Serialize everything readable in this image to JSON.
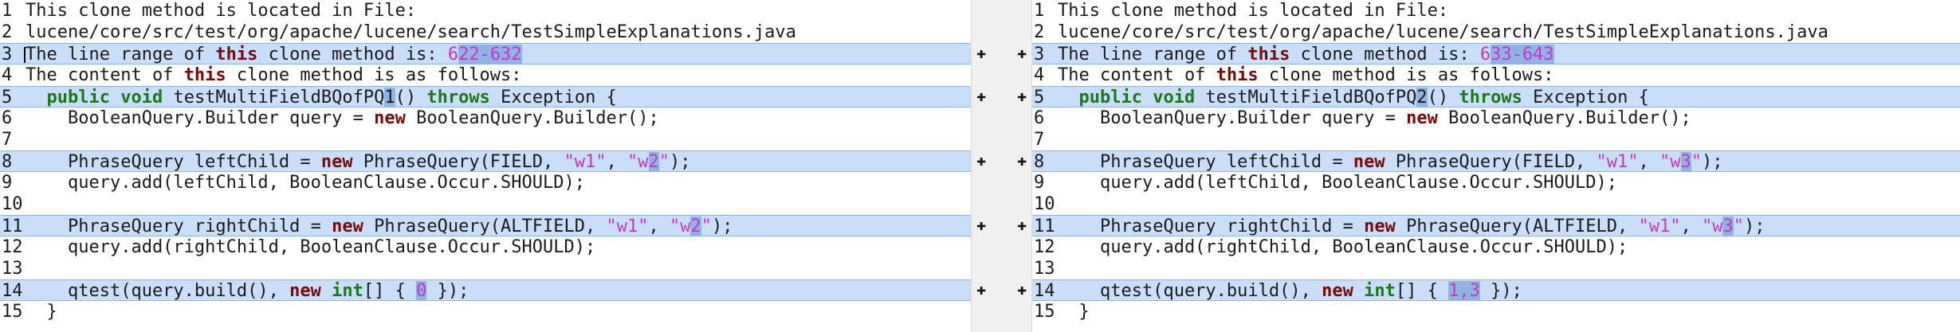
{
  "left": {
    "lines": [
      {
        "n": "1",
        "parts": [
          {
            "t": "This clone method is located in File:"
          }
        ]
      },
      {
        "n": "2",
        "parts": [
          {
            "t": "lucene/core/src/test/org/apache/lucene/search/TestSimpleExplanations.java"
          }
        ]
      },
      {
        "n": "3",
        "parts": [
          {
            "t": "The line range of "
          },
          {
            "t": "this",
            "c": "kw"
          },
          {
            "t": " clone method is: "
          },
          {
            "t": "6",
            "c": "num"
          },
          {
            "t": "22-632",
            "c": "num hl"
          }
        ]
      },
      {
        "n": "4",
        "parts": [
          {
            "t": "The content of "
          },
          {
            "t": "this",
            "c": "kw"
          },
          {
            "t": " clone method is as follows:"
          }
        ]
      },
      {
        "n": "5",
        "parts": [
          {
            "t": "  "
          },
          {
            "t": "public",
            "c": "kw2"
          },
          {
            "t": " "
          },
          {
            "t": "void",
            "c": "kw2"
          },
          {
            "t": " testMultiFieldBQofPQ"
          },
          {
            "t": "1",
            "c": "hl"
          },
          {
            "t": "() "
          },
          {
            "t": "throws",
            "c": "kw2"
          },
          {
            "t": " Exception {"
          }
        ]
      },
      {
        "n": "6",
        "parts": [
          {
            "t": "    BooleanQuery.Builder query = "
          },
          {
            "t": "new",
            "c": "kw"
          },
          {
            "t": " BooleanQuery.Builder();"
          }
        ]
      },
      {
        "n": "7",
        "parts": [
          {
            "t": ""
          }
        ]
      },
      {
        "n": "8",
        "parts": [
          {
            "t": "    PhraseQuery leftChild = "
          },
          {
            "t": "new",
            "c": "kw"
          },
          {
            "t": " PhraseQuery(FIELD, "
          },
          {
            "t": "\"w1\"",
            "c": "str"
          },
          {
            "t": ", "
          },
          {
            "t": "\"w",
            "c": "str"
          },
          {
            "t": "2",
            "c": "str hl"
          },
          {
            "t": "\"",
            "c": "str"
          },
          {
            "t": ");"
          }
        ]
      },
      {
        "n": "9",
        "parts": [
          {
            "t": "    query.add(leftChild, BooleanClause.Occur.SHOULD);"
          }
        ]
      },
      {
        "n": "10",
        "parts": [
          {
            "t": ""
          }
        ]
      },
      {
        "n": "11",
        "parts": [
          {
            "t": "    PhraseQuery rightChild = "
          },
          {
            "t": "new",
            "c": "kw"
          },
          {
            "t": " PhraseQuery(ALTFIELD, "
          },
          {
            "t": "\"w1\"",
            "c": "str"
          },
          {
            "t": ", "
          },
          {
            "t": "\"w",
            "c": "str"
          },
          {
            "t": "2",
            "c": "str hl"
          },
          {
            "t": "\"",
            "c": "str"
          },
          {
            "t": ");"
          }
        ]
      },
      {
        "n": "12",
        "parts": [
          {
            "t": "    query.add(rightChild, BooleanClause.Occur.SHOULD);"
          }
        ]
      },
      {
        "n": "13",
        "parts": [
          {
            "t": ""
          }
        ]
      },
      {
        "n": "14",
        "parts": [
          {
            "t": "    qtest(query.build(), "
          },
          {
            "t": "new",
            "c": "kw"
          },
          {
            "t": " "
          },
          {
            "t": "int",
            "c": "kw2"
          },
          {
            "t": "[] { "
          },
          {
            "t": "0",
            "c": "num hl"
          },
          {
            "t": " });"
          }
        ]
      },
      {
        "n": "15",
        "parts": [
          {
            "t": "  }"
          }
        ]
      }
    ]
  },
  "right": {
    "lines": [
      {
        "n": "1",
        "parts": [
          {
            "t": "This clone method is located in File:"
          }
        ]
      },
      {
        "n": "2",
        "parts": [
          {
            "t": "lucene/core/src/test/org/apache/lucene/search/TestSimpleExplanations.java"
          }
        ]
      },
      {
        "n": "3",
        "parts": [
          {
            "t": "The line range of "
          },
          {
            "t": "this",
            "c": "kw"
          },
          {
            "t": " clone method is: "
          },
          {
            "t": "6",
            "c": "num"
          },
          {
            "t": "33-643",
            "c": "num hl"
          }
        ]
      },
      {
        "n": "4",
        "parts": [
          {
            "t": "The content of "
          },
          {
            "t": "this",
            "c": "kw"
          },
          {
            "t": " clone method is as follows:"
          }
        ]
      },
      {
        "n": "5",
        "parts": [
          {
            "t": "  "
          },
          {
            "t": "public",
            "c": "kw2"
          },
          {
            "t": " "
          },
          {
            "t": "void",
            "c": "kw2"
          },
          {
            "t": " testMultiFieldBQofPQ"
          },
          {
            "t": "2",
            "c": "hl"
          },
          {
            "t": "() "
          },
          {
            "t": "throws",
            "c": "kw2"
          },
          {
            "t": " Exception {"
          }
        ]
      },
      {
        "n": "6",
        "parts": [
          {
            "t": "    BooleanQuery.Builder query = "
          },
          {
            "t": "new",
            "c": "kw"
          },
          {
            "t": " BooleanQuery.Builder();"
          }
        ]
      },
      {
        "n": "7",
        "parts": [
          {
            "t": ""
          }
        ]
      },
      {
        "n": "8",
        "parts": [
          {
            "t": "    PhraseQuery leftChild = "
          },
          {
            "t": "new",
            "c": "kw"
          },
          {
            "t": " PhraseQuery(FIELD, "
          },
          {
            "t": "\"w1\"",
            "c": "str"
          },
          {
            "t": ", "
          },
          {
            "t": "\"w",
            "c": "str"
          },
          {
            "t": "3",
            "c": "str hl"
          },
          {
            "t": "\"",
            "c": "str"
          },
          {
            "t": ");"
          }
        ]
      },
      {
        "n": "9",
        "parts": [
          {
            "t": "    query.add(leftChild, BooleanClause.Occur.SHOULD);"
          }
        ]
      },
      {
        "n": "10",
        "parts": [
          {
            "t": ""
          }
        ]
      },
      {
        "n": "11",
        "parts": [
          {
            "t": "    PhraseQuery rightChild = "
          },
          {
            "t": "new",
            "c": "kw"
          },
          {
            "t": " PhraseQuery(ALTFIELD, "
          },
          {
            "t": "\"w1\"",
            "c": "str"
          },
          {
            "t": ", "
          },
          {
            "t": "\"w",
            "c": "str"
          },
          {
            "t": "3",
            "c": "str hl"
          },
          {
            "t": "\"",
            "c": "str"
          },
          {
            "t": ");"
          }
        ]
      },
      {
        "n": "12",
        "parts": [
          {
            "t": "    query.add(rightChild, BooleanClause.Occur.SHOULD);"
          }
        ]
      },
      {
        "n": "13",
        "parts": [
          {
            "t": ""
          }
        ]
      },
      {
        "n": "14",
        "parts": [
          {
            "t": "    qtest(query.build(), "
          },
          {
            "t": "new",
            "c": "kw"
          },
          {
            "t": " "
          },
          {
            "t": "int",
            "c": "kw2"
          },
          {
            "t": "[] { "
          },
          {
            "t": "1,3",
            "c": "num hl"
          },
          {
            "t": " });"
          }
        ]
      },
      {
        "n": "15",
        "parts": [
          {
            "t": "  }"
          }
        ]
      }
    ]
  },
  "changed_lines": [
    "3",
    "5",
    "8",
    "11",
    "14"
  ],
  "marker_symbol": "✚",
  "colors": {
    "changed_bg": "#c9defa",
    "highlight_bg": "#8fb3e3",
    "keyword": "#7a0a0a",
    "type_keyword": "#1a7a1a",
    "string": "#cc33cc",
    "gutter_bg": "#f0f0f0"
  }
}
